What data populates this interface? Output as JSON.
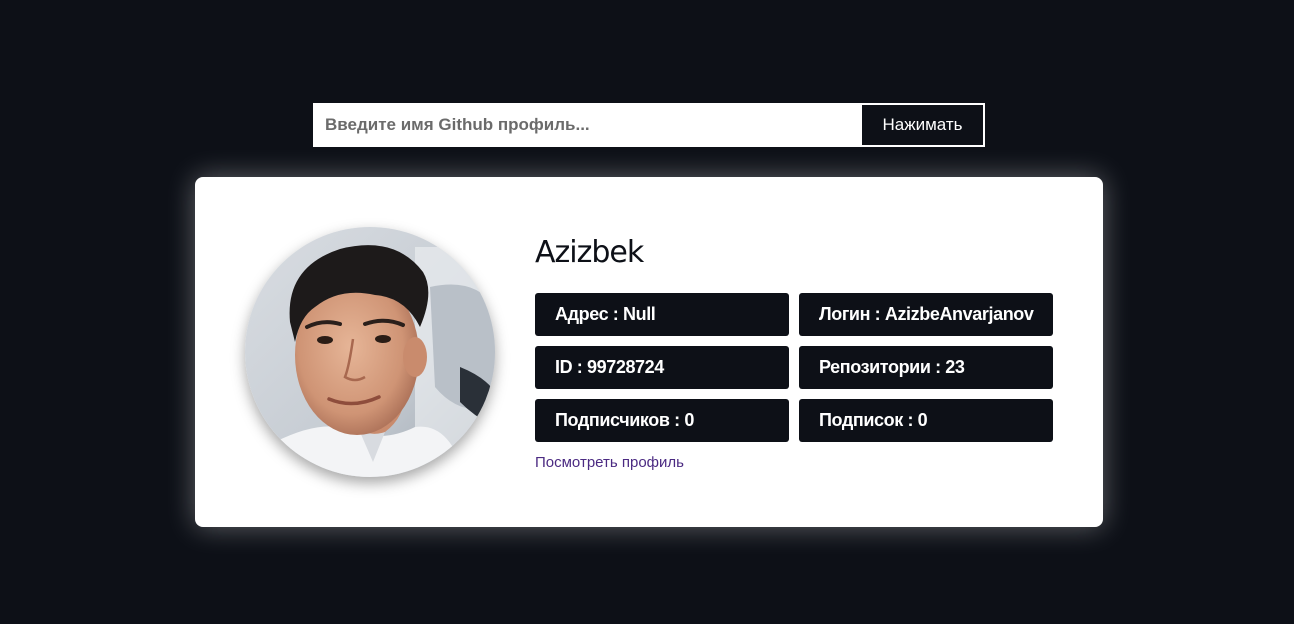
{
  "search": {
    "placeholder": "Введите имя Github профиль...",
    "value": "",
    "button_label": "Нажимать"
  },
  "profile": {
    "name": "Azizbek",
    "avatar_description": "avatar-photo",
    "stats": [
      {
        "label": "Адрес",
        "value": "Null",
        "text": "Адрес : Null"
      },
      {
        "label": "Логин",
        "value": "AzizbeAnvarjanov",
        "text": "Логин : AzizbeAnvarjanov"
      },
      {
        "label": "ID",
        "value": "99728724",
        "text": "ID : 99728724"
      },
      {
        "label": "Репозитории",
        "value": "23",
        "text": "Репозитории : 23"
      },
      {
        "label": "Подписчиков",
        "value": "0",
        "text": "Подписчиков : 0"
      },
      {
        "label": "Подписок",
        "value": "0",
        "text": "Подписок : 0"
      }
    ],
    "link_label": "Посмотреть профиль"
  },
  "colors": {
    "background": "#0d1017",
    "card": "#ffffff",
    "stat_bg": "#0d1017",
    "link": "#4b2a82"
  }
}
